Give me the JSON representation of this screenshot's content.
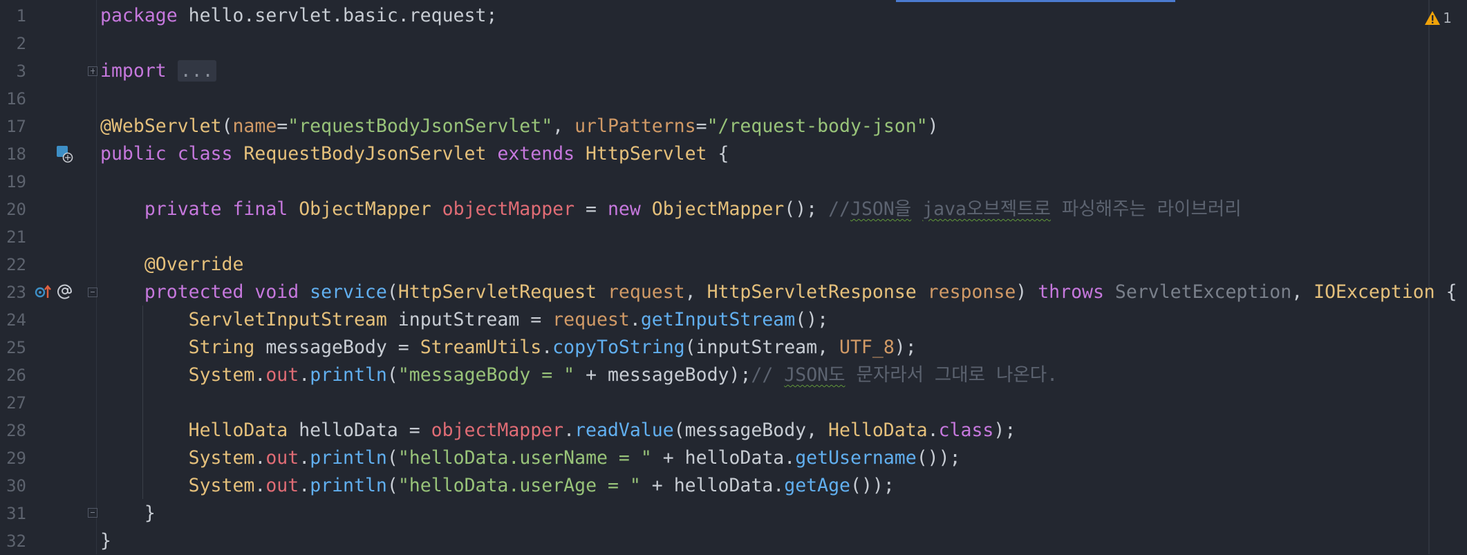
{
  "editor": {
    "warnings_count": "1",
    "lines": [
      {
        "n": "1",
        "tokens": [
          {
            "t": "package ",
            "c": "kw"
          },
          {
            "t": "hello.servlet.basic.request;",
            "c": ""
          }
        ]
      },
      {
        "n": "2",
        "tokens": []
      },
      {
        "n": "3",
        "tokens": [
          {
            "t": "import ",
            "c": "kw"
          },
          {
            "t": "...",
            "c": "fold-box"
          }
        ]
      },
      {
        "n": "16",
        "tokens": []
      },
      {
        "n": "17",
        "tokens": [
          {
            "t": "@WebServlet",
            "c": "type"
          },
          {
            "t": "(",
            "c": ""
          },
          {
            "t": "name",
            "c": "par"
          },
          {
            "t": "=",
            "c": ""
          },
          {
            "t": "\"requestBodyJsonServlet\"",
            "c": "str"
          },
          {
            "t": ", ",
            "c": ""
          },
          {
            "t": "urlPatterns",
            "c": "par"
          },
          {
            "t": "=",
            "c": ""
          },
          {
            "t": "\"/request-body-json\"",
            "c": "str"
          },
          {
            "t": ")",
            "c": ""
          }
        ]
      },
      {
        "n": "18",
        "tokens": [
          {
            "t": "public ",
            "c": "kw"
          },
          {
            "t": "class ",
            "c": "kw"
          },
          {
            "t": "RequestBodyJsonServlet ",
            "c": "type"
          },
          {
            "t": "extends ",
            "c": "kw"
          },
          {
            "t": "HttpServlet",
            "c": "type"
          },
          {
            "t": " {",
            "c": ""
          }
        ]
      },
      {
        "n": "19",
        "tokens": []
      },
      {
        "n": "20",
        "tokens": [
          {
            "t": "    ",
            "c": ""
          },
          {
            "t": "private ",
            "c": "kw"
          },
          {
            "t": "final ",
            "c": "kw"
          },
          {
            "t": "ObjectMapper ",
            "c": "type"
          },
          {
            "t": "objectMapper",
            "c": "fld"
          },
          {
            "t": " = ",
            "c": ""
          },
          {
            "t": "new ",
            "c": "kw"
          },
          {
            "t": "ObjectMapper",
            "c": "type"
          },
          {
            "t": "(); ",
            "c": ""
          },
          {
            "t": "//",
            "c": "cmt"
          },
          {
            "t": "JSON을",
            "c": "cmt sq"
          },
          {
            "t": " ",
            "c": "cmt"
          },
          {
            "t": "java오브젝트로",
            "c": "cmt sq"
          },
          {
            "t": " 파싱해주는 라이브러리",
            "c": "cmt"
          }
        ]
      },
      {
        "n": "21",
        "tokens": []
      },
      {
        "n": "22",
        "tokens": [
          {
            "t": "    ",
            "c": ""
          },
          {
            "t": "@Override",
            "c": "type"
          }
        ]
      },
      {
        "n": "23",
        "tokens": [
          {
            "t": "    ",
            "c": ""
          },
          {
            "t": "protected ",
            "c": "kw"
          },
          {
            "t": "void ",
            "c": "kw"
          },
          {
            "t": "service",
            "c": "fn"
          },
          {
            "t": "(",
            "c": ""
          },
          {
            "t": "HttpServletRequest ",
            "c": "type"
          },
          {
            "t": "request",
            "c": "par"
          },
          {
            "t": ", ",
            "c": ""
          },
          {
            "t": "HttpServletResponse ",
            "c": "type"
          },
          {
            "t": "response",
            "c": "par"
          },
          {
            "t": ") ",
            "c": ""
          },
          {
            "t": "throws ",
            "c": "kw"
          },
          {
            "t": "ServletException",
            "c": "dim"
          },
          {
            "t": ", ",
            "c": ""
          },
          {
            "t": "IOException",
            "c": "type"
          },
          {
            "t": " {",
            "c": ""
          }
        ]
      },
      {
        "n": "24",
        "tokens": [
          {
            "t": "        ",
            "c": ""
          },
          {
            "t": "ServletInputStream ",
            "c": "type"
          },
          {
            "t": "inputStream = ",
            "c": ""
          },
          {
            "t": "request",
            "c": "par"
          },
          {
            "t": ".",
            "c": ""
          },
          {
            "t": "getInputStream",
            "c": "fn"
          },
          {
            "t": "();",
            "c": ""
          }
        ]
      },
      {
        "n": "25",
        "tokens": [
          {
            "t": "        ",
            "c": ""
          },
          {
            "t": "String ",
            "c": "type"
          },
          {
            "t": "messageBody = ",
            "c": ""
          },
          {
            "t": "StreamUtils",
            "c": "type"
          },
          {
            "t": ".",
            "c": ""
          },
          {
            "t": "copyToString",
            "c": "fn"
          },
          {
            "t": "(inputStream, ",
            "c": ""
          },
          {
            "t": "UTF_8",
            "c": "par"
          },
          {
            "t": ");",
            "c": ""
          }
        ]
      },
      {
        "n": "26",
        "tokens": [
          {
            "t": "        ",
            "c": ""
          },
          {
            "t": "System",
            "c": "type"
          },
          {
            "t": ".",
            "c": ""
          },
          {
            "t": "out",
            "c": "fld"
          },
          {
            "t": ".",
            "c": ""
          },
          {
            "t": "println",
            "c": "fn"
          },
          {
            "t": "(",
            "c": ""
          },
          {
            "t": "\"messageBody = \"",
            "c": "str"
          },
          {
            "t": " + messageBody);",
            "c": ""
          },
          {
            "t": "// ",
            "c": "cmt"
          },
          {
            "t": "JSON도",
            "c": "cmt sq"
          },
          {
            "t": " 문자라서 그대로 나온다.",
            "c": "cmt"
          }
        ]
      },
      {
        "n": "27",
        "tokens": []
      },
      {
        "n": "28",
        "tokens": [
          {
            "t": "        ",
            "c": ""
          },
          {
            "t": "HelloData ",
            "c": "type"
          },
          {
            "t": "helloData = ",
            "c": ""
          },
          {
            "t": "objectMapper",
            "c": "fld"
          },
          {
            "t": ".",
            "c": ""
          },
          {
            "t": "readValue",
            "c": "fn"
          },
          {
            "t": "(messageBody, ",
            "c": ""
          },
          {
            "t": "HelloData",
            "c": "type"
          },
          {
            "t": ".",
            "c": ""
          },
          {
            "t": "class",
            "c": "kw"
          },
          {
            "t": ");",
            "c": ""
          }
        ]
      },
      {
        "n": "29",
        "tokens": [
          {
            "t": "        ",
            "c": ""
          },
          {
            "t": "System",
            "c": "type"
          },
          {
            "t": ".",
            "c": ""
          },
          {
            "t": "out",
            "c": "fld"
          },
          {
            "t": ".",
            "c": ""
          },
          {
            "t": "println",
            "c": "fn"
          },
          {
            "t": "(",
            "c": ""
          },
          {
            "t": "\"helloData.userName = \"",
            "c": "str"
          },
          {
            "t": " + helloData.",
            "c": ""
          },
          {
            "t": "getUsername",
            "c": "fn"
          },
          {
            "t": "());",
            "c": ""
          }
        ]
      },
      {
        "n": "30",
        "tokens": [
          {
            "t": "        ",
            "c": ""
          },
          {
            "t": "System",
            "c": "type"
          },
          {
            "t": ".",
            "c": ""
          },
          {
            "t": "out",
            "c": "fld"
          },
          {
            "t": ".",
            "c": ""
          },
          {
            "t": "println",
            "c": "fn"
          },
          {
            "t": "(",
            "c": ""
          },
          {
            "t": "\"helloData.userAge = \"",
            "c": "str"
          },
          {
            "t": " + helloData.",
            "c": ""
          },
          {
            "t": "getAge",
            "c": "fn"
          },
          {
            "t": "());",
            "c": ""
          }
        ]
      },
      {
        "n": "31",
        "tokens": [
          {
            "t": "    ",
            "c": ""
          },
          {
            "t": "}",
            "c": ""
          }
        ]
      },
      {
        "n": "32",
        "tokens": [
          {
            "t": "}",
            "c": ""
          }
        ]
      }
    ]
  }
}
